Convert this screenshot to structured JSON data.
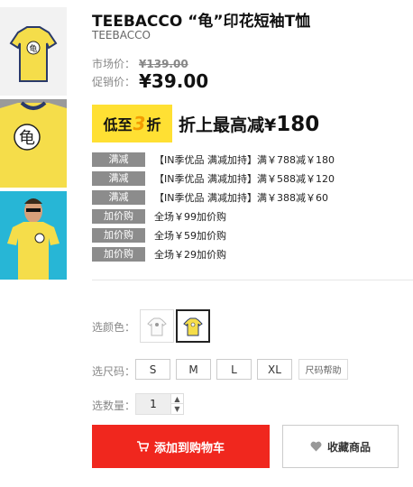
{
  "product": {
    "title": "TEEBACCO “龟”印花短袖T恤",
    "brand": "TEEBACCO"
  },
  "price": {
    "market_label": "市场价：",
    "market_value": "¥139.00",
    "promo_label": "促销价：",
    "promo_value": "¥39.00"
  },
  "banner": {
    "badge_prefix": "低至",
    "badge_num": "3",
    "badge_suffix": "折",
    "text": "折上最高减¥",
    "amount": "180"
  },
  "promotions": [
    {
      "tag": "满减",
      "text": "【IN季优品 满减加持】满￥788减￥180"
    },
    {
      "tag": "满减",
      "text": "【IN季优品 满减加持】满￥588减￥120"
    },
    {
      "tag": "满减",
      "text": "【IN季优品 满减加持】满￥388减￥60"
    },
    {
      "tag": "加价购",
      "text": "全场￥99加价购"
    },
    {
      "tag": "加价购",
      "text": "全场￥59加价购"
    },
    {
      "tag": "加价购",
      "text": "全场￥29加价购"
    }
  ],
  "options": {
    "color_label": "选颜色：",
    "size_label": "选尺码：",
    "sizes": [
      "S",
      "M",
      "L",
      "XL"
    ],
    "size_help": "尺码帮助",
    "qty_label": "选数量：",
    "qty_value": "1"
  },
  "actions": {
    "add_to_cart": "添加到购物车",
    "favorite": "收藏商品"
  },
  "colors": {
    "yellow_shirt": "#f5dd4a",
    "red_button": "#f0271e",
    "tag_gray": "#8c8c8c"
  }
}
